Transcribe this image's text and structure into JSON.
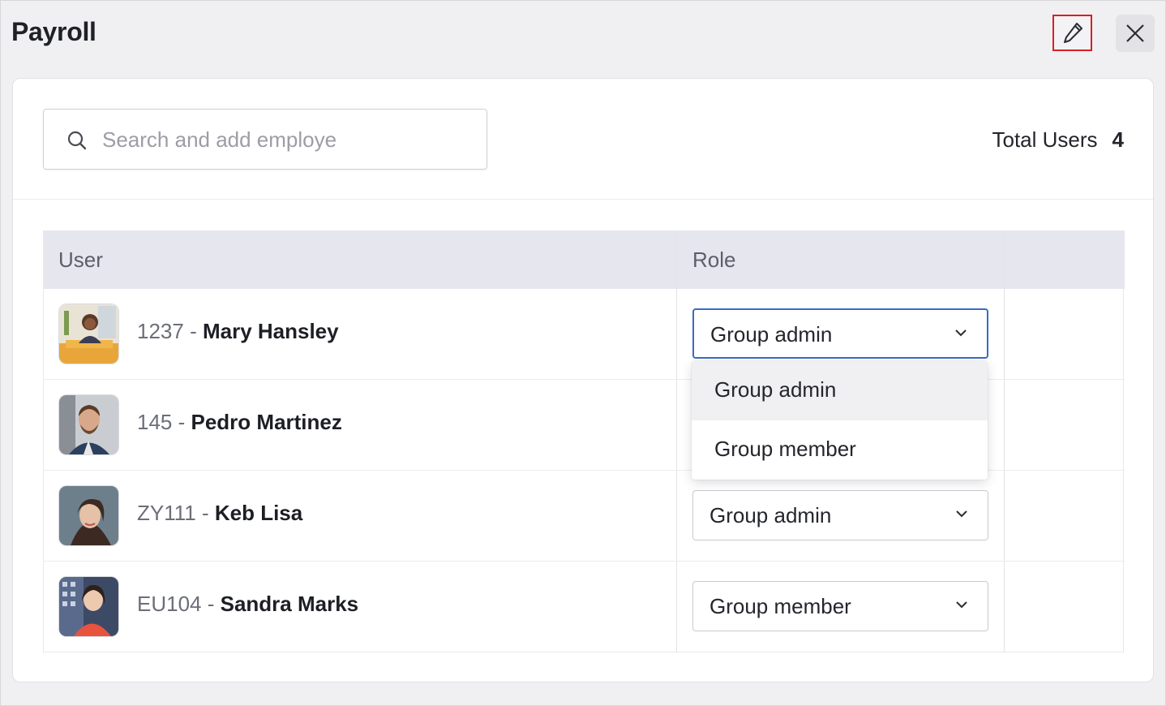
{
  "header": {
    "title": "Payroll",
    "edit_icon": "pencil-icon",
    "close_icon": "close-icon",
    "edit_highlight_color": "#d81f26"
  },
  "search": {
    "icon": "search-icon",
    "placeholder": "Search and add employees"
  },
  "summary": {
    "total_label": "Total Users",
    "total_count": "4"
  },
  "table": {
    "columns": [
      "User",
      "Role",
      ""
    ],
    "rows": [
      {
        "id": "1237 - ",
        "name": "Mary Hansley",
        "role": "Group admin"
      },
      {
        "id": "145 - ",
        "name": "Pedro Martinez",
        "role": ""
      },
      {
        "id": "ZY111 - ",
        "name": "Keb Lisa",
        "role": "Group admin"
      },
      {
        "id": "EU104 - ",
        "name": "Sandra Marks",
        "role": "Group member"
      }
    ]
  },
  "role_dropdown": {
    "open_for_row": 0,
    "options": [
      "Group admin",
      "Group member"
    ],
    "highlighted": "Group admin",
    "focus_color": "#3a6bc4"
  },
  "colors": {
    "header_bg": "#e6e6ef",
    "page_bg": "#f0f0f2"
  }
}
